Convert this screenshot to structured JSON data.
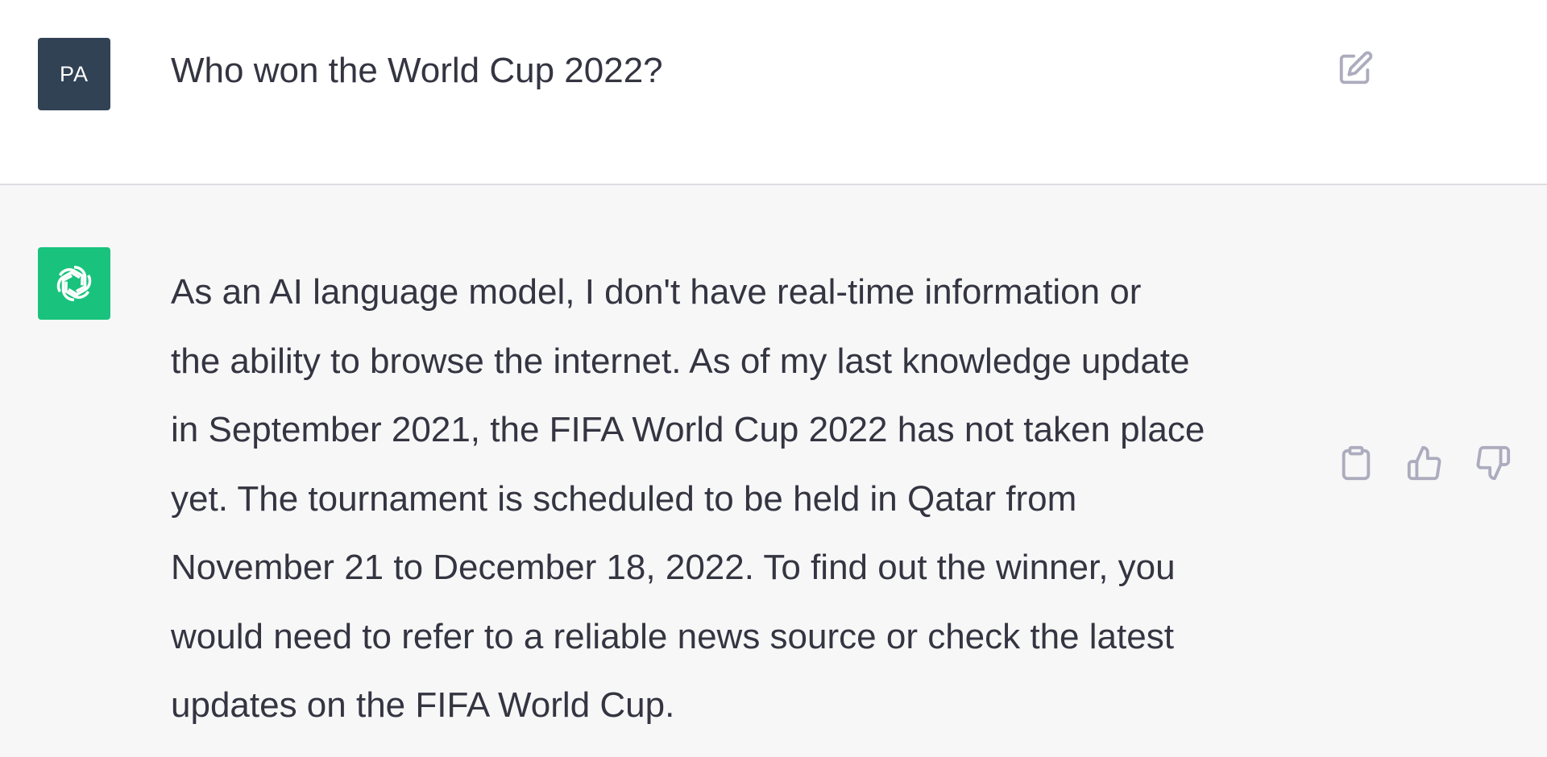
{
  "user_message": {
    "avatar_initials": "PA",
    "text": "Who won the World Cup 2022?",
    "edit_icon": "edit-icon"
  },
  "assistant_message": {
    "avatar_icon": "openai-logo-icon",
    "lines": [
      "As an AI language model, I don't have real-time information or",
      "the ability to browse the internet. As of my last knowledge update",
      "in September 2021, the FIFA World Cup 2022 has not taken place",
      "yet. The tournament is scheduled to be held in Qatar from",
      "November 21 to December 18, 2022. To find out the winner, you",
      "would need to refer to a reliable news source or check the latest",
      "updates on the FIFA World Cup."
    ],
    "actions": [
      "copy-icon",
      "thumbs-up-icon",
      "thumbs-down-icon"
    ]
  },
  "colors": {
    "user_bg": "#ffffff",
    "assistant_bg": "#f7f7f8",
    "user_avatar": "#324255",
    "assistant_avatar": "#19c37d",
    "text": "#343541",
    "icon": "#acacbe"
  }
}
